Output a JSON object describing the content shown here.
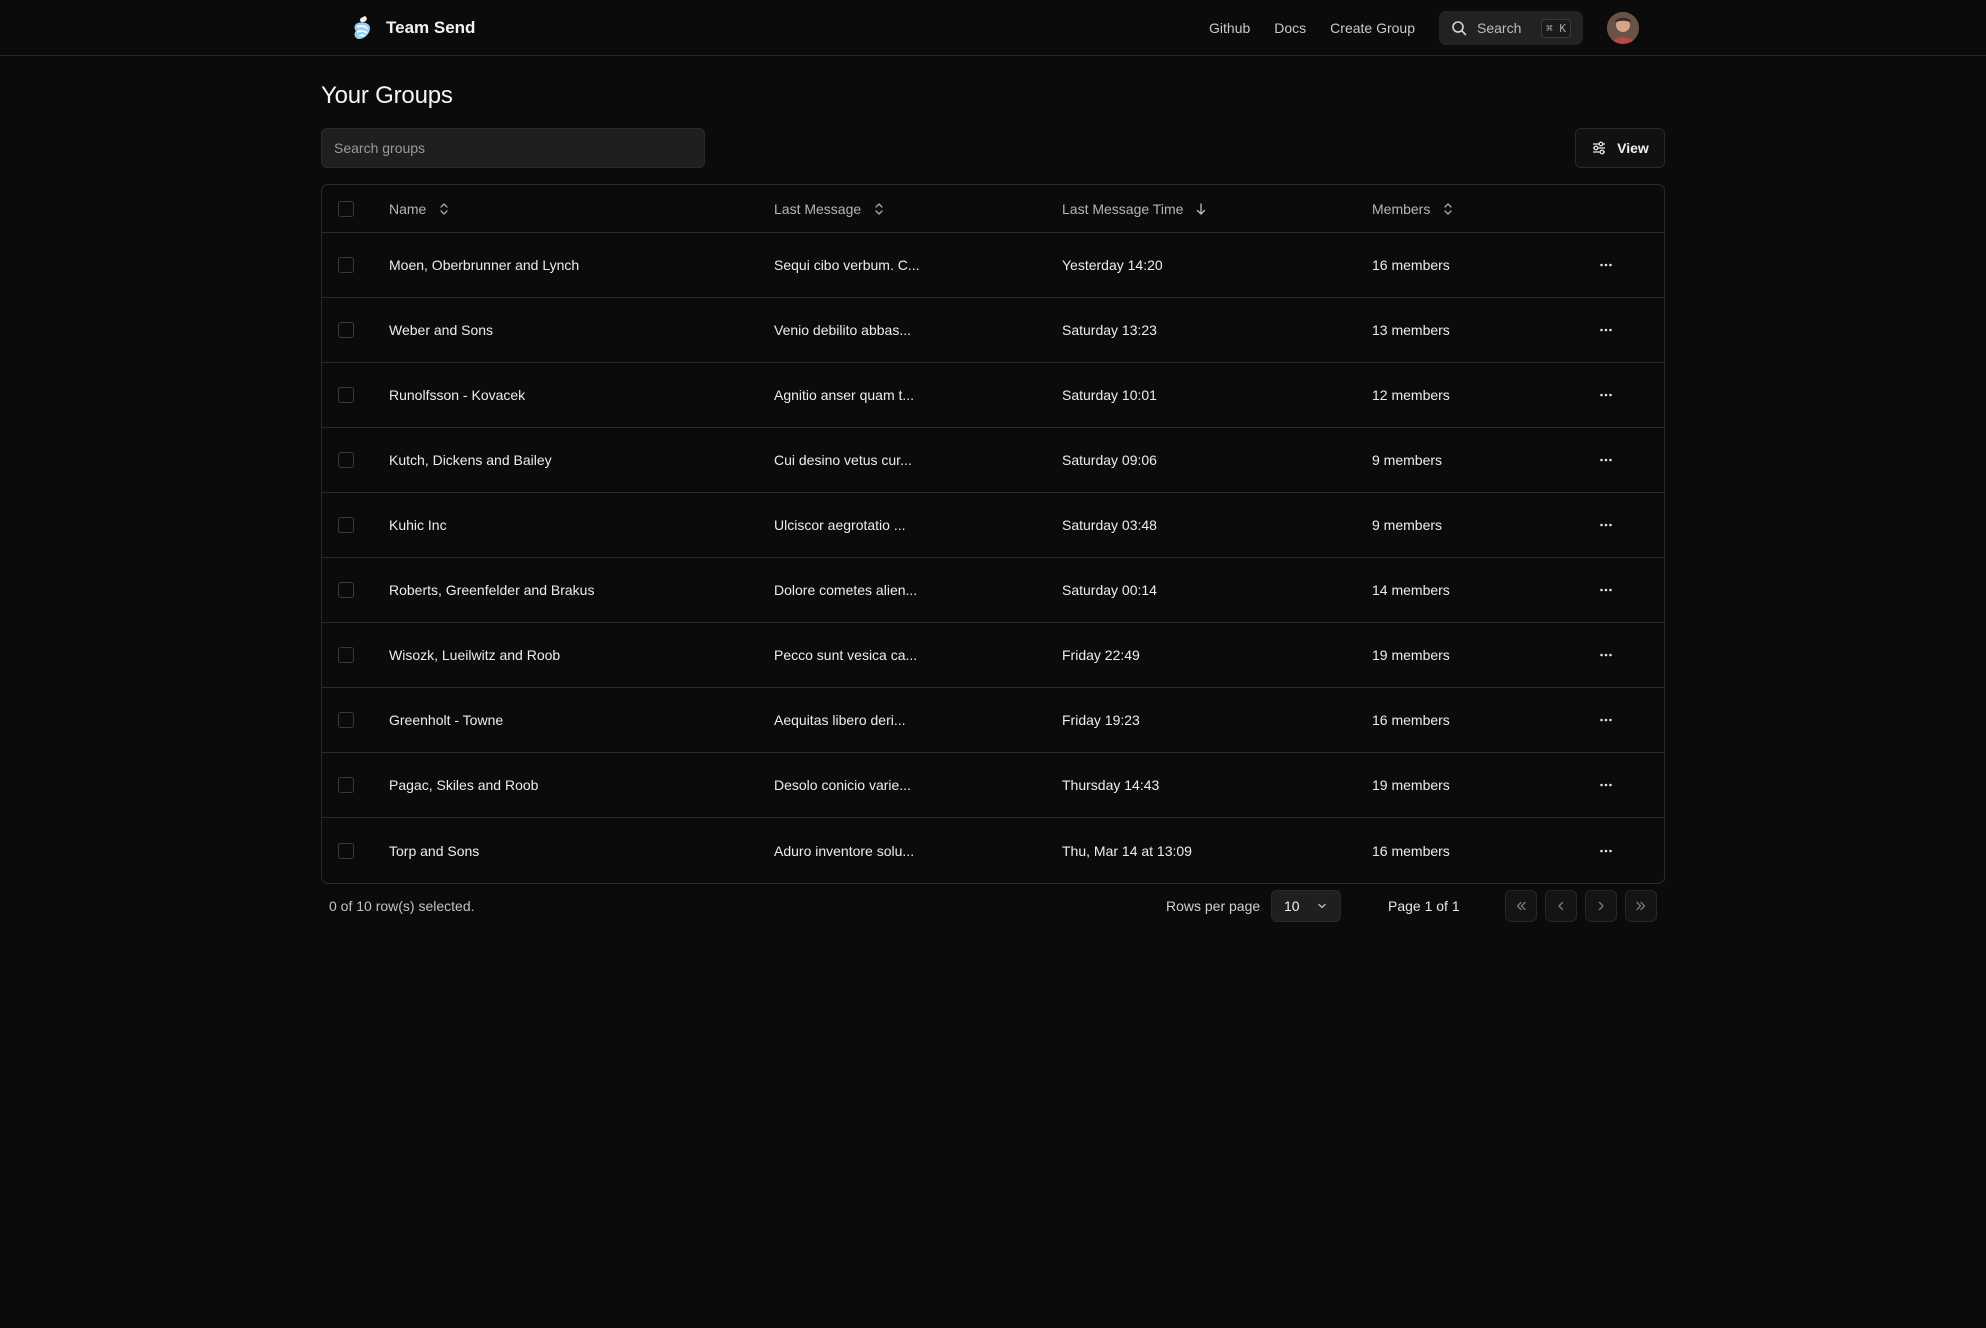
{
  "header": {
    "app_name": "Team Send",
    "nav": [
      "Github",
      "Docs",
      "Create Group"
    ],
    "search_label": "Search",
    "search_shortcut": "⌘ K"
  },
  "page": {
    "title": "Your Groups",
    "search_placeholder": "Search groups",
    "view_label": "View"
  },
  "table": {
    "columns": {
      "name": "Name",
      "last_message": "Last Message",
      "last_message_time": "Last Message Time",
      "members": "Members"
    },
    "rows": [
      {
        "name": "Moen, Oberbrunner and Lynch",
        "last_message": "Sequi cibo verbum. C...",
        "time": "Yesterday 14:20",
        "members": "16 members"
      },
      {
        "name": "Weber and Sons",
        "last_message": "Venio debilito abbas...",
        "time": "Saturday 13:23",
        "members": "13 members"
      },
      {
        "name": "Runolfsson - Kovacek",
        "last_message": "Agnitio anser quam t...",
        "time": "Saturday 10:01",
        "members": "12 members"
      },
      {
        "name": "Kutch, Dickens and Bailey",
        "last_message": "Cui desino vetus cur...",
        "time": "Saturday 09:06",
        "members": "9 members"
      },
      {
        "name": "Kuhic Inc",
        "last_message": "Ulciscor aegrotatio ...",
        "time": "Saturday 03:48",
        "members": "9 members"
      },
      {
        "name": "Roberts, Greenfelder and Brakus",
        "last_message": "Dolore cometes alien...",
        "time": "Saturday 00:14",
        "members": "14 members"
      },
      {
        "name": "Wisozk, Lueilwitz and Roob",
        "last_message": "Pecco sunt vesica ca...",
        "time": "Friday 22:49",
        "members": "19 members"
      },
      {
        "name": "Greenholt - Towne",
        "last_message": "Aequitas libero deri...",
        "time": "Friday 19:23",
        "members": "16 members"
      },
      {
        "name": "Pagac, Skiles and Roob",
        "last_message": "Desolo conicio varie...",
        "time": "Thursday 14:43",
        "members": "19 members"
      },
      {
        "name": "Torp and Sons",
        "last_message": "Aduro inventore solu...",
        "time": "Thu, Mar 14 at 13:09",
        "members": "16 members"
      }
    ]
  },
  "footer": {
    "selected_text": "0 of 10 row(s) selected.",
    "rows_per_page_label": "Rows per page",
    "rows_per_page_value": "10",
    "page_info": "Page 1 of 1"
  },
  "icons": {
    "logo": "team-send-logo-icon",
    "search": "search-icon",
    "view": "sliders-icon",
    "sort": "sort-updown-icon",
    "sort_active": "arrow-down-icon",
    "row_action": "more-horizontal-icon",
    "chevron": "chevron-down-icon",
    "first_page": "chevrons-left-icon",
    "prev_page": "chevron-left-icon",
    "next_page": "chevron-right-icon",
    "last_page": "chevrons-right-icon"
  },
  "colors": {
    "background": "#0b0b0b",
    "border": "#2a2a2a",
    "text": "#ededed",
    "muted": "#b5b5b5"
  }
}
